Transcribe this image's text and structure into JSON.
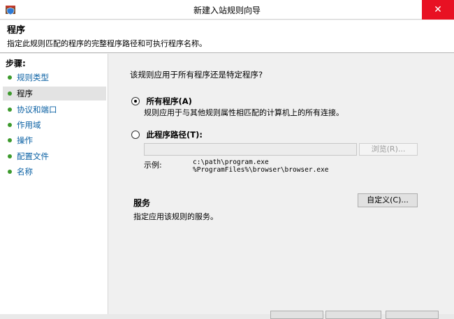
{
  "window": {
    "title": "新建入站规则向导",
    "close_glyph": "✕",
    "icon": "firewall-shield-icon"
  },
  "header": {
    "title": "程序",
    "description": "指定此规则匹配的程序的完整程序路径和可执行程序名称。"
  },
  "steps": {
    "title": "步骤:",
    "items": [
      {
        "label": "规则类型",
        "active": false
      },
      {
        "label": "程序",
        "active": true
      },
      {
        "label": "协议和端口",
        "active": false
      },
      {
        "label": "作用域",
        "active": false
      },
      {
        "label": "操作",
        "active": false
      },
      {
        "label": "配置文件",
        "active": false
      },
      {
        "label": "名称",
        "active": false
      }
    ]
  },
  "main": {
    "question": "该规则应用于所有程序还是特定程序?",
    "option_all": {
      "label": "所有程序(A)",
      "description": "规则应用于与其他规则属性相匹配的计算机上的所有连接。",
      "checked": true
    },
    "option_path": {
      "label": "此程序路径(T):",
      "checked": false,
      "value": "",
      "browse_label": "浏览(R)...",
      "example_label": "示例:",
      "example_line1": "c:\\path\\program.exe",
      "example_line2": "%ProgramFiles%\\browser\\browser.exe"
    },
    "service": {
      "title": "服务",
      "description": "指定应用该规则的服务。",
      "customize_label": "自定义(C)..."
    }
  },
  "colors": {
    "close_button": "#e81123",
    "step_link": "#0b61a4",
    "step_bullet": "#3c9a2c"
  }
}
